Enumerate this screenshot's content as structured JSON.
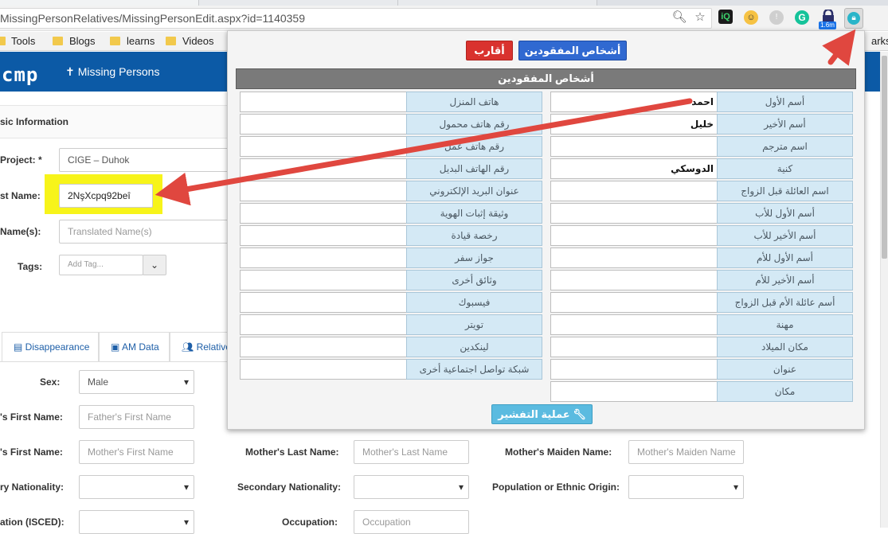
{
  "browser": {
    "url": "MissingPersonRelatives/MissingPersonEdit.aspx?id=1140359",
    "ext_badge": "1.6m",
    "bookmarks": [
      {
        "label": "Tools"
      },
      {
        "label": "Blogs"
      },
      {
        "label": "learns"
      },
      {
        "label": "Videos"
      }
    ],
    "bookmarks_other": "arks"
  },
  "app": {
    "logo": "cmp",
    "nav_title": "Missing Persons"
  },
  "form": {
    "section_title": "sic Information",
    "project_label": "Project: *",
    "project_value": "CIGE – Duhok",
    "first_name_label": "st Name:",
    "first_name_value": "2NşXcpq92beî",
    "translated_label": "Name(s):",
    "translated_placeholder": "Translated Name(s)",
    "tags_label": "Tags:",
    "tags_placeholder": "Add Tag...",
    "tabs": [
      {
        "label": "Disappearance"
      },
      {
        "label": "AM Data"
      },
      {
        "label": "Relative"
      }
    ],
    "sex_label": "Sex:",
    "sex_value": "Male",
    "fathers_first_label": "'s First Name:",
    "fathers_first_placeholder": "Father's First Name",
    "mothers_first_label": "'s First Name:",
    "mothers_first_placeholder": "Mother's First Name",
    "mothers_last_label": "Mother's Last Name:",
    "mothers_last_placeholder": "Mother's Last Name",
    "mothers_maiden_label": "Mother's Maiden Name:",
    "mothers_maiden_placeholder": "Mother's Maiden Name",
    "primary_nat_label": "ry Nationality:",
    "secondary_nat_label": "Secondary Nationality:",
    "ethnic_label": "Population or Ethnic Origin:",
    "education_label": "ation (ISCED):",
    "occupation_label": "Occupation:",
    "occupation_placeholder": "Occupation"
  },
  "popup": {
    "btn_relatives": "أقارب",
    "btn_missing": "أشخاص المفقودين",
    "title": "أشخاص المفقودين",
    "left_rows": [
      {
        "label": "هاتف المنزل",
        "value": ""
      },
      {
        "label": "رقم هاتف محمول",
        "value": ""
      },
      {
        "label": "رقم هاتف عمل",
        "value": ""
      },
      {
        "label": "رقم الهاتف البديل",
        "value": ""
      },
      {
        "label": "عنوان البريد الإلكتروني",
        "value": ""
      },
      {
        "label": "وثيقة إثبات الهوية",
        "value": ""
      },
      {
        "label": "رخصة قيادة",
        "value": ""
      },
      {
        "label": "جواز سفر",
        "value": ""
      },
      {
        "label": "وثائق أخرى",
        "value": ""
      },
      {
        "label": "فيسبوك",
        "value": ""
      },
      {
        "label": "تويتر",
        "value": ""
      },
      {
        "label": "لينكدين",
        "value": ""
      },
      {
        "label": "شبكة تواصل اجتماعية أخرى",
        "value": ""
      }
    ],
    "right_rows": [
      {
        "label": "أسم الأول",
        "value": "احمد"
      },
      {
        "label": "أسم الأخير",
        "value": "خليل"
      },
      {
        "label": "اسم مترجم",
        "value": ""
      },
      {
        "label": "كنية",
        "value": "الدوسكي"
      },
      {
        "label": "اسم العائلة قبل الزواج",
        "value": ""
      },
      {
        "label": "أسم الأول للأب",
        "value": ""
      },
      {
        "label": "أسم الأخير للأب",
        "value": ""
      },
      {
        "label": "أسم الأول للأم",
        "value": ""
      },
      {
        "label": "أسم الأخير للأم",
        "value": ""
      },
      {
        "label": "أسم عائلة الأم قبل الزواج",
        "value": ""
      },
      {
        "label": "مهنة",
        "value": ""
      },
      {
        "label": "مكان الميلاد",
        "value": ""
      },
      {
        "label": "عنوان",
        "value": ""
      },
      {
        "label": "مكان",
        "value": ""
      }
    ],
    "decrypt_button": "عملية التفشير"
  },
  "colors": {
    "header_blue": "#0c5aa6",
    "highlight_yellow": "#f7f41a",
    "annotation_red": "#e0473f",
    "label_cell_bg": "#d4e9f5"
  }
}
